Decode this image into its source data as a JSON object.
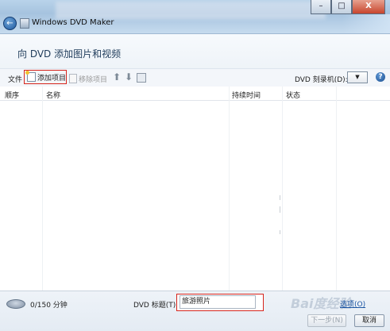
{
  "window": {
    "title": "Windows DVD Maker",
    "minimize_label": "–",
    "maximize_label": "□",
    "close_label": "X"
  },
  "header": {
    "title": "向 DVD 添加图片和视频"
  },
  "toolbar": {
    "file_label": "文件",
    "add_items_label": "添加项目",
    "remove_items_label": "移除项目",
    "burner_label": "DVD 刻录机(D):",
    "help_label": "?"
  },
  "list": {
    "columns": [
      "顺序",
      "名称",
      "持续时间",
      "状态"
    ],
    "rows": []
  },
  "footer": {
    "capacity": "0/150 分钟",
    "dvd_title_label": "DVD 标题(T):",
    "dvd_title_value": "旅游照片",
    "options_link": "选项(O)",
    "next_button": "下一步(N)",
    "cancel_button": "取消",
    "watermark": "Bai度经验"
  },
  "colors": {
    "highlight_border": "#d6241c",
    "link": "#1b55a3"
  }
}
